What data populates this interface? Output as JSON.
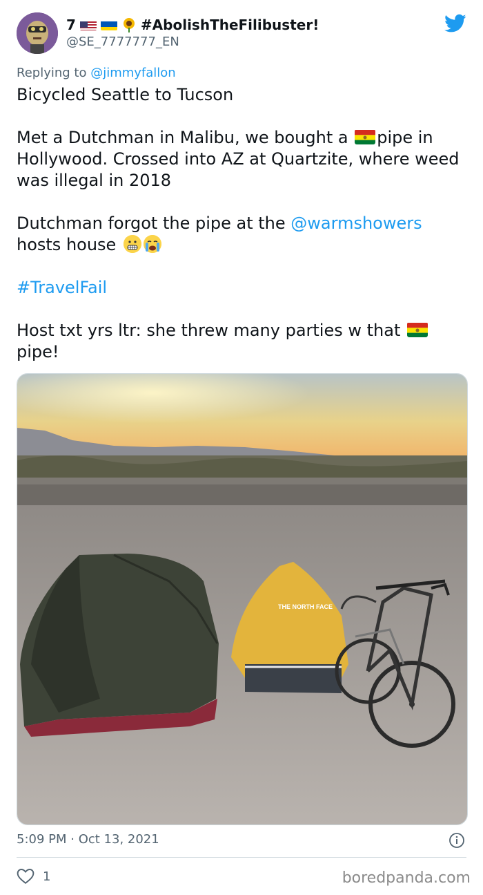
{
  "user": {
    "display_name_prefix": "7",
    "hashtag_name": "#AbolishTheFilibuster!",
    "handle": "@SE_7777777_EN",
    "flags": [
      "us-flag-icon",
      "ukraine-flag-icon",
      "sunflower-icon"
    ]
  },
  "reply": {
    "prefix": "Replying to ",
    "mention": "@jimmyfallon"
  },
  "tweet": {
    "line1": "Bicycled Seattle to Tucson",
    "para2_a": "Met a Dutchman in Malibu, we bought a ",
    "para2_b": "pipe in Hollywood. Crossed into AZ at Quartzite, where weed was illegal in 2018",
    "para3_a": "Dutchman forgot the pipe at the ",
    "para3_mention": "@warmshowers",
    "para3_b": " hosts house",
    "hashtag": "#TravelFail",
    "para5_a": "Host txt yrs ltr: she threw many parties w that ",
    "para5_b": "pipe!",
    "emojis": [
      "grimacing-face-icon",
      "crying-face-icon"
    ]
  },
  "photo": {
    "tent_brand": "THE NORTH FACE"
  },
  "meta": {
    "time": "5:09 PM",
    "separator": " · ",
    "date": "Oct 13, 2021"
  },
  "actions": {
    "like_count": "1"
  },
  "watermark": "boredpanda.com",
  "colors": {
    "accent": "#1d9bf0",
    "secondary_text": "#536471",
    "divider": "#cfd9de"
  }
}
